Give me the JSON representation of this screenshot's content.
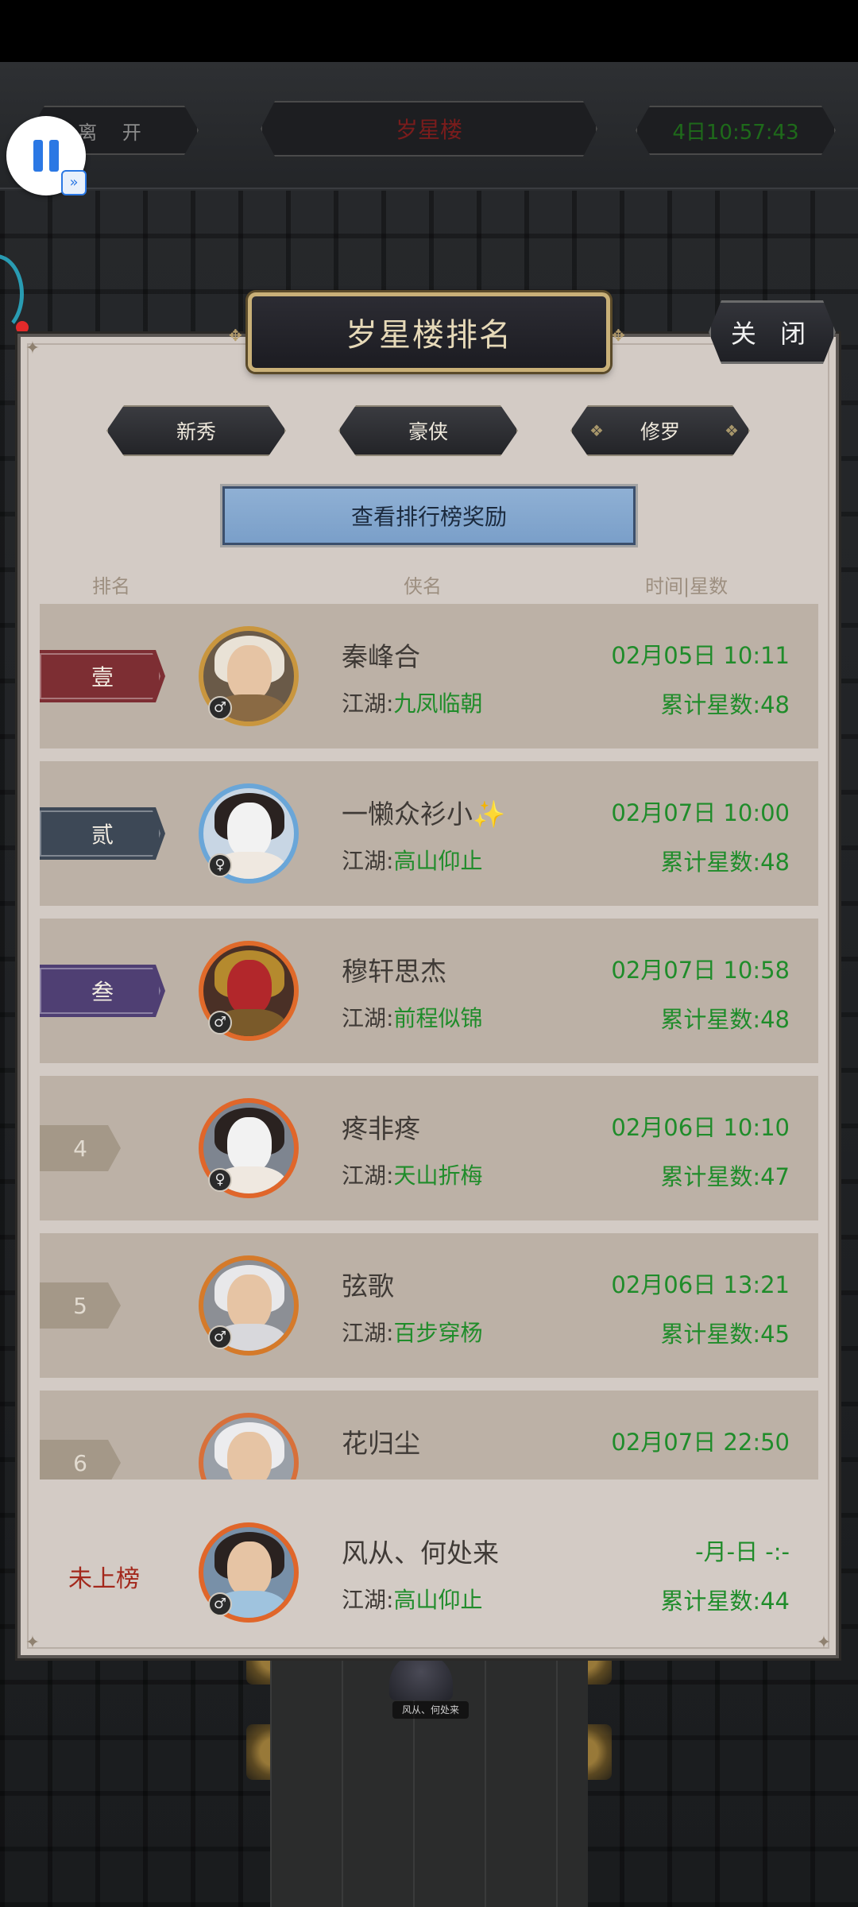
{
  "top_bar": {
    "leave_label": "离 开",
    "location_title": "岁星楼",
    "timer": "4日10:57:43"
  },
  "recorder": {
    "pause_icon": "pause-icon",
    "fast_forward_icon": "fast-forward-icon"
  },
  "panel": {
    "title": "岁星楼排名",
    "close_label": "关 闭",
    "tabs": [
      {
        "label": "新秀"
      },
      {
        "label": "豪侠"
      },
      {
        "label": "修罗"
      }
    ],
    "reward_button": "查看排行榜奖励",
    "columns": {
      "rank": "排名",
      "name": "侠名",
      "time_stars": "时间|星数"
    }
  },
  "rankings": [
    {
      "rank": "壹",
      "name": "秦峰合",
      "jianghu_label": "江湖:",
      "jianghu": "九凤临朝",
      "time": "02月05日 10:11",
      "stars_label": "累计星数:",
      "stars": "48",
      "gender": "male",
      "badge_color": "#7d2e33"
    },
    {
      "rank": "贰",
      "name": "一懒众衫小✨",
      "jianghu_label": "江湖:",
      "jianghu": "高山仰止",
      "time": "02月07日 10:00",
      "stars_label": "累计星数:",
      "stars": "48",
      "gender": "female",
      "badge_color": "#3d4856"
    },
    {
      "rank": "叁",
      "name": "穆轩思杰",
      "jianghu_label": "江湖:",
      "jianghu": "前程似锦",
      "time": "02月07日 10:58",
      "stars_label": "累计星数:",
      "stars": "48",
      "gender": "male",
      "badge_color": "#4f3f73"
    },
    {
      "rank": "4",
      "name": "疼非疼",
      "jianghu_label": "江湖:",
      "jianghu": "天山折梅",
      "time": "02月06日 10:10",
      "stars_label": "累计星数:",
      "stars": "47",
      "gender": "female"
    },
    {
      "rank": "5",
      "name": "弦歌",
      "jianghu_label": "江湖:",
      "jianghu": "百步穿杨",
      "time": "02月06日 13:21",
      "stars_label": "累计星数:",
      "stars": "45",
      "gender": "male"
    },
    {
      "rank": "6",
      "name": "花归尘",
      "jianghu_label": "",
      "jianghu": "",
      "time": "02月07日 22:50",
      "stars_label": "",
      "stars": "",
      "gender": "male"
    }
  ],
  "self": {
    "status": "未上榜",
    "name": "风从、何处来",
    "jianghu_label": "江湖:",
    "jianghu": "高山仰止",
    "time": "-月-日 -:-",
    "stars_label": "累计星数:",
    "stars": "44",
    "gender": "male"
  },
  "background": {
    "character_label": "风从、何处来"
  }
}
